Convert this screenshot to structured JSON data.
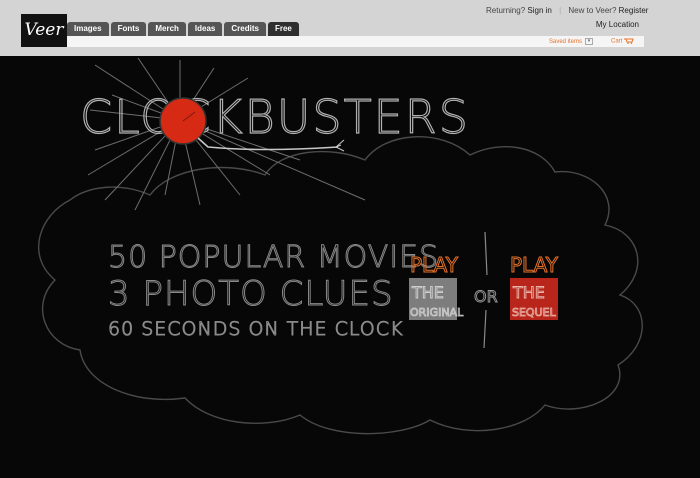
{
  "brand": {
    "logo_text": "Veer"
  },
  "nav": {
    "tabs": [
      "Images",
      "Fonts",
      "Merch",
      "Ideas",
      "Credits",
      "Free"
    ]
  },
  "account": {
    "returning_label": "Returning?",
    "sign_in": "Sign in",
    "new_label": "New to Veer?",
    "register": "Register",
    "my_location": "My Location",
    "saved_items": "Saved items",
    "cart": "Cart"
  },
  "game": {
    "title": "CLOCKBUSTERS",
    "lines": [
      "50 POPULAR MOVIES",
      "3 PHOTO CLUES",
      "60 SECONDS ON THE CLOCK"
    ],
    "option_original": {
      "play": "PLAY",
      "the": "THE",
      "name": "ORIGINAL"
    },
    "or": "OR",
    "option_sequel": {
      "play": "PLAY",
      "the": "THE",
      "name": "SEQUEL"
    }
  },
  "colors": {
    "accent_orange": "#e7722a",
    "clock_red": "#d62a14",
    "sequel_red": "#b8251a",
    "original_gray": "#7d7d7d"
  }
}
